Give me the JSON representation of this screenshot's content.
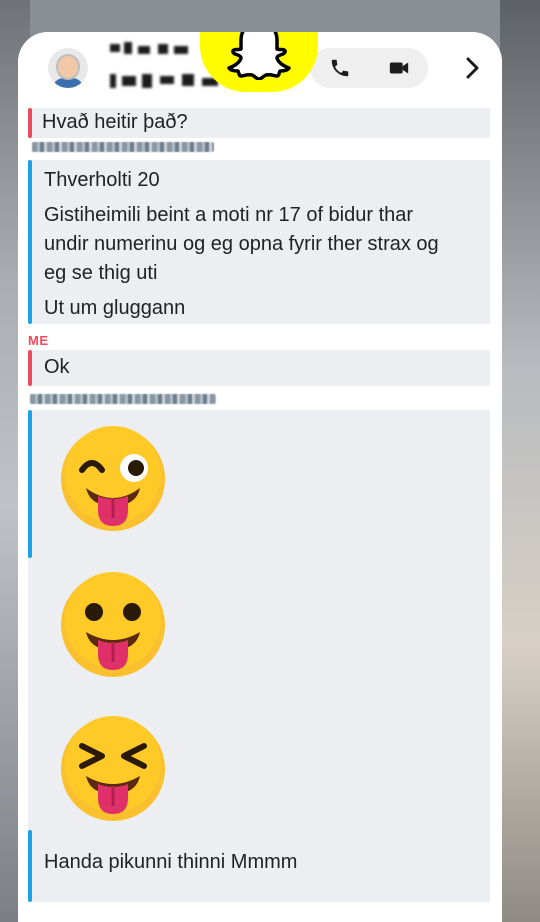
{
  "chat": {
    "messages": [
      {
        "sender": "friend",
        "text": "Hvað heitir það?"
      },
      {
        "sender": "friend",
        "text": "Thverholti 20"
      },
      {
        "sender": "friend",
        "text": "Gistiheimili beint a moti nr 17 of bidur thar undir numerinu og eg opna fyrir ther strax og eg se thig uti"
      },
      {
        "sender": "friend",
        "text": "Ut um gluggann"
      },
      {
        "sender": "me",
        "label": "ME",
        "text": "Ok"
      },
      {
        "sender": "friend",
        "emojis": [
          "winking-face-with-tongue",
          "face-with-tongue",
          "squinting-face-with-tongue"
        ],
        "text": "Handa pikunni thinni Mmmm"
      }
    ],
    "multiline": {
      "line1": "Gistiheimili beint a moti nr 17 of bidur thar",
      "line2": "undir numerinu og eg opna fyrir ther strax og",
      "line3": "eg se thig uti"
    }
  },
  "header": {
    "icons": [
      "avatar",
      "snapchat-ghost-icon",
      "phone-icon",
      "video-icon",
      "chevron-right-icon"
    ]
  },
  "colors": {
    "me": "#f0485c",
    "friend": "#1fa1e8",
    "snap_yellow": "#fffc00",
    "bubble": "#eceef1"
  }
}
